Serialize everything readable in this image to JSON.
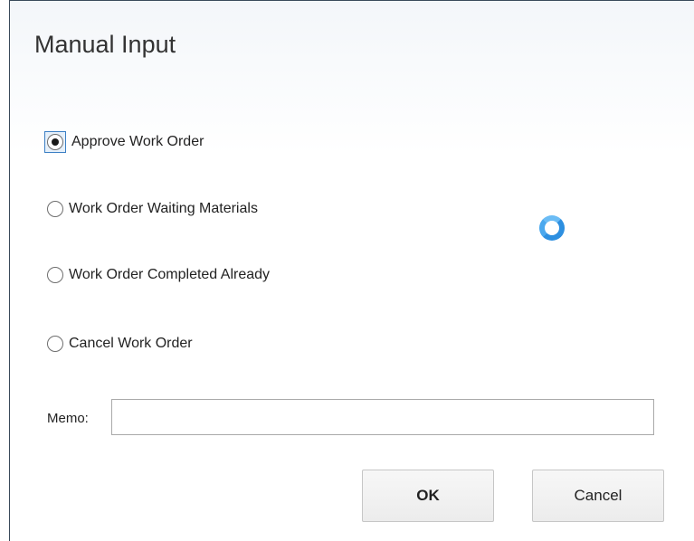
{
  "dialog": {
    "title": "Manual Input",
    "options": [
      {
        "label": "Approve Work Order",
        "checked": true
      },
      {
        "label": "Work Order Waiting Materials",
        "checked": false
      },
      {
        "label": "Work Order Completed Already",
        "checked": false
      },
      {
        "label": "Cancel Work Order",
        "checked": false
      }
    ],
    "memo": {
      "label": "Memo:",
      "value": "",
      "placeholder": ""
    },
    "buttons": {
      "ok_label": "OK",
      "cancel_label": "Cancel"
    }
  },
  "icons": {
    "loading": "loading-spinner-icon"
  },
  "colors": {
    "spinner": "#2d8fe0",
    "focus_ring": "#3b7fc4"
  }
}
